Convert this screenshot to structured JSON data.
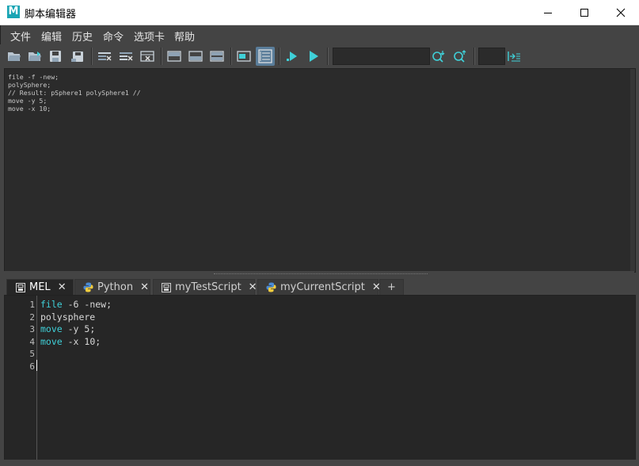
{
  "window": {
    "title": "脚本编辑器",
    "app_icon": "maya-logo-icon",
    "controls": [
      "minimize-icon",
      "maximize-icon",
      "close-icon"
    ]
  },
  "menu": [
    "文件",
    "编辑",
    "历史",
    "命令",
    "选项卡",
    "帮助"
  ],
  "toolbar": {
    "icons": [
      "open-script-icon",
      "source-script-icon",
      "save-script-icon",
      "save-script-to-shelf-icon",
      "clear-history-icon",
      "clear-input-icon",
      "clear-all-icon",
      "show-history-only-icon",
      "show-input-only-icon",
      "show-both-icon",
      "echo-all-commands-icon",
      "show-line-numbers-icon",
      "execute-selected-icon",
      "execute-all-icon",
      "search-down-icon",
      "search-up-icon",
      "goto-line-icon"
    ],
    "search_value": "",
    "line_value": ""
  },
  "history": {
    "lines": [
      "file -f -new;",
      "polySphere;",
      "// Result: pSphere1 polySphere1 //",
      "move -y 5;",
      "move -x 10;"
    ]
  },
  "tabs": [
    {
      "label": "MEL",
      "icon": "mel-icon",
      "active": true
    },
    {
      "label": "Python",
      "icon": "python-icon",
      "active": false
    },
    {
      "label": "myTestScript",
      "icon": "mel-icon",
      "active": false
    },
    {
      "label": "myCurrentScript",
      "icon": "python-icon",
      "active": false
    }
  ],
  "add_tab_label": "+",
  "editor": {
    "line_numbers": [
      "1",
      "2",
      "3",
      "4",
      "5",
      "6"
    ],
    "lines": [
      {
        "kw": "file",
        "rest": " -6 -new;"
      },
      {
        "kw": "",
        "rest": "polysphere"
      },
      {
        "kw": "move",
        "rest": " -y 5;"
      },
      {
        "kw": "move",
        "rest": " -x 10;"
      },
      {
        "kw": "",
        "rest": ""
      },
      {
        "kw": "",
        "rest": ""
      }
    ],
    "keyword_color": "#3fd0d8"
  },
  "colors": {
    "panel_bg": "#444444",
    "editor_bg": "#262626",
    "history_bg": "#2b2b2b",
    "accent": "#5a7d9a"
  }
}
